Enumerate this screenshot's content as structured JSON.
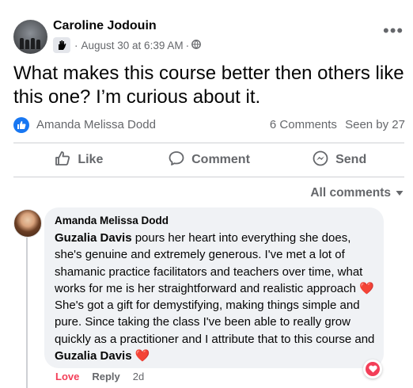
{
  "post": {
    "author": "Caroline Jodouin",
    "timestamp": "August 30 at 6:39 AM",
    "separator": "·",
    "text": "What makes this course better then others like this one? I’m curious about it."
  },
  "stats": {
    "reactor": "Amanda Melissa Dodd",
    "comments": "6 Comments",
    "seen": "Seen by 27"
  },
  "actions": {
    "like": "Like",
    "comment": "Comment",
    "send": "Send"
  },
  "filter": {
    "label": "All comments"
  },
  "comment": {
    "author": "Amanda Melissa Dodd",
    "tag1": "Guzalia Davis",
    "part1": " pours her heart into everything she does, she's genuine and extremely generous. I've met a lot of shamanic practice facilitators and teachers over time, what works for me is her straightforward and realistic approach ",
    "part2": " She's got a gift for demystifying, making things simple and pure. Since taking the class I've been able to really grow quickly as a practitioner and I attribute that to this course and ",
    "tag2": "Guzalia Davis",
    "heart": "❤️",
    "love_label": "Love",
    "reply_label": "Reply",
    "age": "2d"
  },
  "icons": {
    "group": "group-hand-icon",
    "audience": "globe-icon",
    "more": "more-options-icon",
    "like_badge": "thumbs-up-icon",
    "like": "like-icon",
    "comment": "comment-icon",
    "send": "messenger-icon",
    "dropdown": "caret-down-icon",
    "reaction": "heart-reaction-icon"
  },
  "colors": {
    "brand_blue": "#1877f2",
    "secondary_text": "#65676b",
    "love_red": "#f33e58",
    "bubble_bg": "#f0f2f5"
  }
}
